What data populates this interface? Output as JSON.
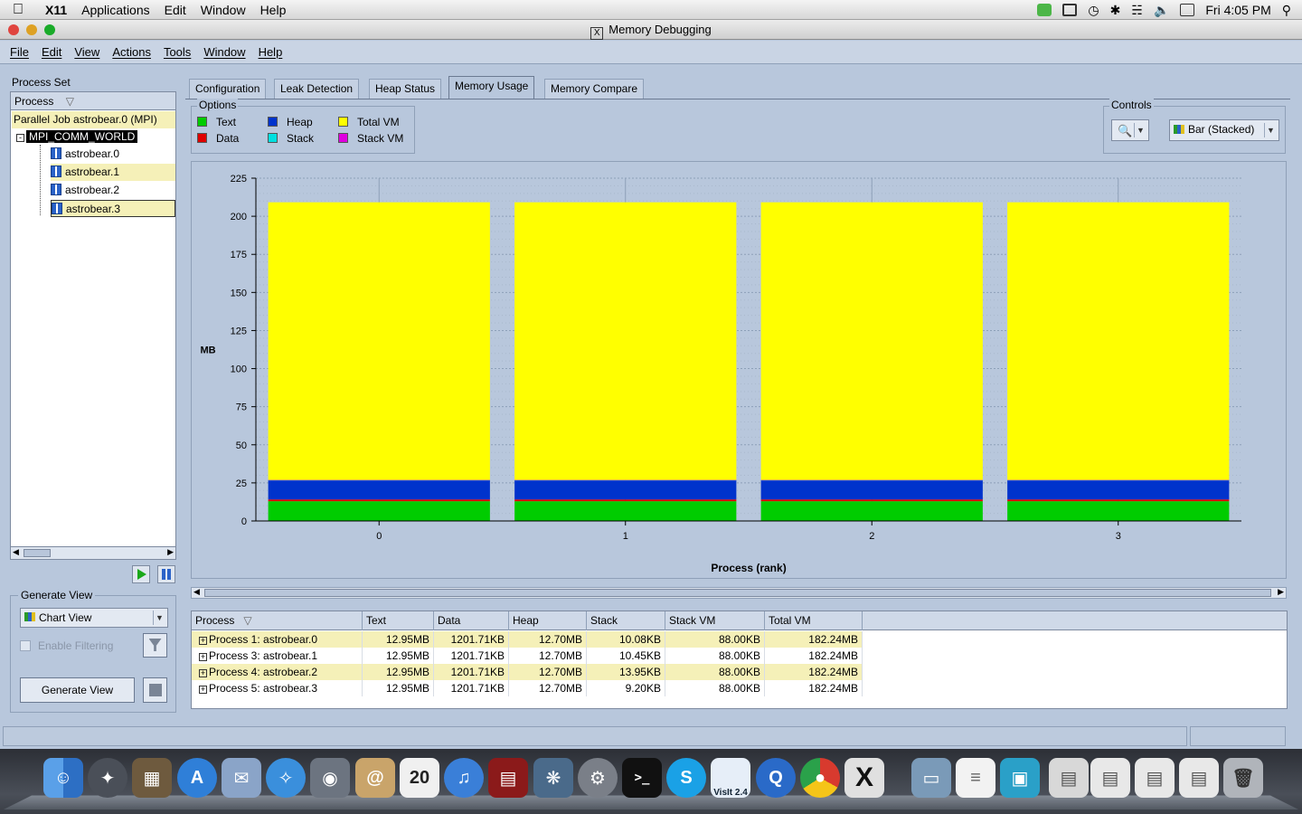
{
  "macos": {
    "app_name": "X11",
    "menus": [
      "Applications",
      "Edit",
      "Window",
      "Help"
    ],
    "clock": "Fri 4:05 PM"
  },
  "window": {
    "title": "Memory Debugging"
  },
  "menubar": [
    "File",
    "Edit",
    "View",
    "Actions",
    "Tools",
    "Window",
    "Help"
  ],
  "process_set": {
    "label": "Process Set",
    "column": "Process",
    "job": "Parallel Job astrobear.0 (MPI)",
    "group": "MPI_COMM_WORLD",
    "processes": [
      "astrobear.0",
      "astrobear.1",
      "astrobear.2",
      "astrobear.3"
    ]
  },
  "generate_view": {
    "label": "Generate View",
    "view_select": "Chart View",
    "filter_label": "Enable Filtering",
    "button": "Generate View"
  },
  "tabs": [
    "Configuration",
    "Leak Detection",
    "Heap Status",
    "Memory Usage",
    "Memory Compare"
  ],
  "active_tab": "Memory Usage",
  "options": {
    "label": "Options",
    "items": [
      {
        "label": "Text",
        "color": "#00cc00"
      },
      {
        "label": "Heap",
        "color": "#0033cc"
      },
      {
        "label": "Total VM",
        "color": "#ffff00"
      },
      {
        "label": "Data",
        "color": "#e00000"
      },
      {
        "label": "Stack",
        "color": "#00e0e0"
      },
      {
        "label": "Stack VM",
        "color": "#e000e0"
      }
    ]
  },
  "controls": {
    "label": "Controls",
    "chart_type": "Bar (Stacked)"
  },
  "chart_data": {
    "type": "bar",
    "stacked": true,
    "categories": [
      "0",
      "1",
      "2",
      "3"
    ],
    "xlabel": "Process (rank)",
    "ylabel": "MB",
    "ylim": [
      0,
      225
    ],
    "yticks": [
      0,
      25,
      50,
      75,
      100,
      125,
      150,
      175,
      200,
      225
    ],
    "grid": true,
    "series": [
      {
        "name": "Text",
        "color": "#00cc00",
        "values": [
          12.95,
          12.95,
          12.95,
          12.95
        ]
      },
      {
        "name": "Data",
        "color": "#e00000",
        "values": [
          1.17,
          1.17,
          1.17,
          1.17
        ]
      },
      {
        "name": "Heap",
        "color": "#0033cc",
        "values": [
          12.7,
          12.7,
          12.7,
          12.7
        ]
      },
      {
        "name": "Stack",
        "color": "#00e0e0",
        "values": [
          0.01,
          0.01,
          0.01,
          0.01
        ]
      },
      {
        "name": "Stack VM",
        "color": "#e000e0",
        "values": [
          0.09,
          0.09,
          0.09,
          0.09
        ]
      },
      {
        "name": "Total VM",
        "color": "#ffff00",
        "values": [
          182.24,
          182.24,
          182.24,
          182.24
        ]
      }
    ]
  },
  "table": {
    "columns": [
      "Process",
      "Text",
      "Data",
      "Heap",
      "Stack",
      "Stack VM",
      "Total VM"
    ],
    "rows": [
      [
        "Process 1: astrobear.0",
        "12.95MB",
        "1201.71KB",
        "12.70MB",
        "10.08KB",
        "88.00KB",
        "182.24MB"
      ],
      [
        "Process 3: astrobear.1",
        "12.95MB",
        "1201.71KB",
        "12.70MB",
        "10.45KB",
        "88.00KB",
        "182.24MB"
      ],
      [
        "Process 4: astrobear.2",
        "12.95MB",
        "1201.71KB",
        "12.70MB",
        "13.95KB",
        "88.00KB",
        "182.24MB"
      ],
      [
        "Process 5: astrobear.3",
        "12.95MB",
        "1201.71KB",
        "12.70MB",
        "9.20KB",
        "88.00KB",
        "182.24MB"
      ]
    ]
  },
  "dock": {
    "calendar_day": "20",
    "visit_label": "VisIt 2.4"
  }
}
